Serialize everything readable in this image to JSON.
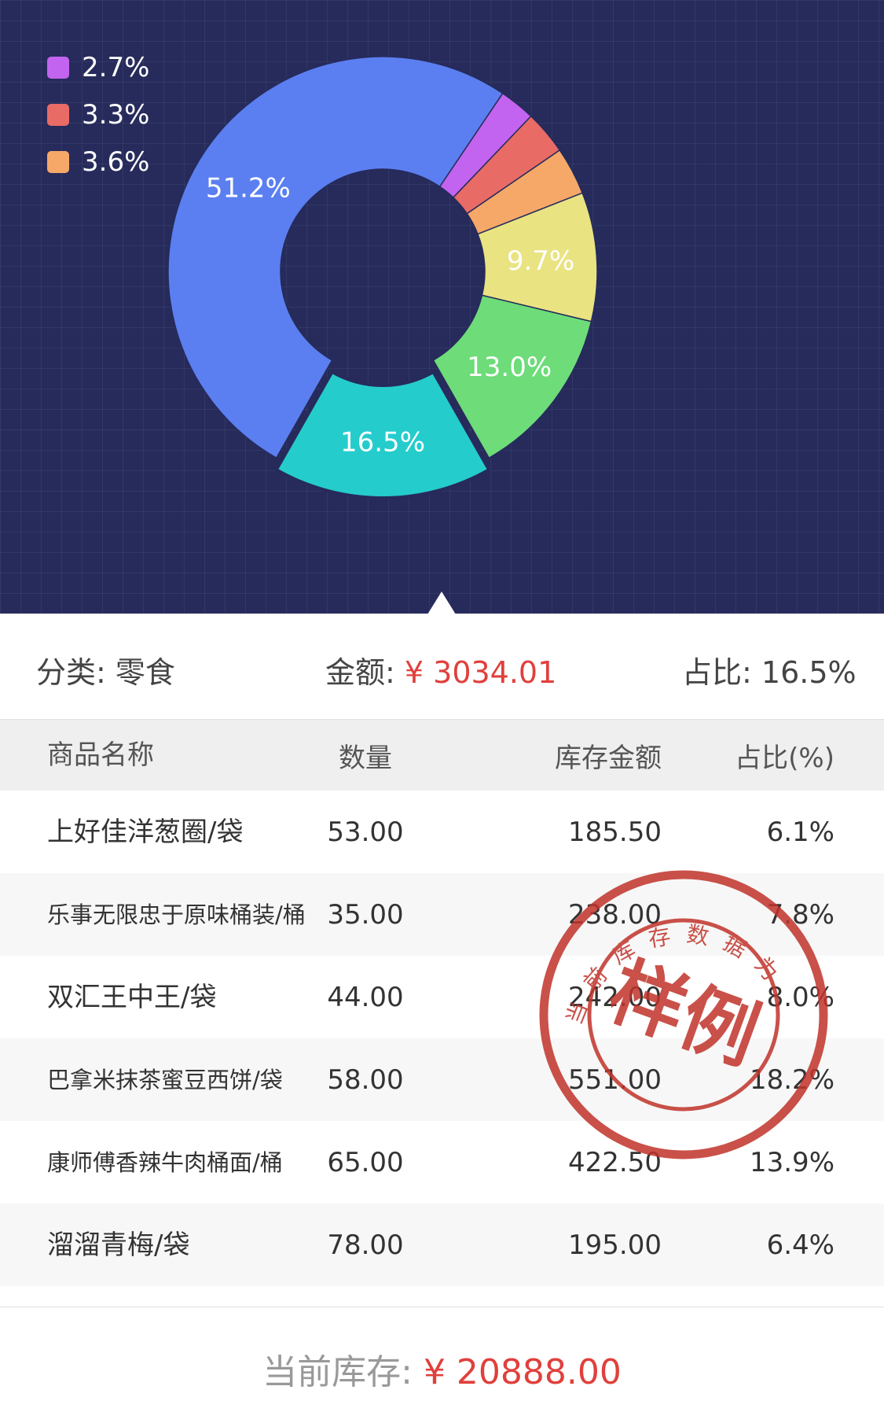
{
  "chart_data": {
    "type": "pie",
    "subtype": "donut",
    "slices": [
      {
        "label": "51.2%",
        "value": 51.2,
        "color": "#5b7ff0",
        "show_label": true
      },
      {
        "label": "2.7%",
        "value": 2.7,
        "color": "#c264ef",
        "show_label": false
      },
      {
        "label": "3.3%",
        "value": 3.3,
        "color": "#e86b66",
        "show_label": false
      },
      {
        "label": "3.6%",
        "value": 3.6,
        "color": "#f5a867",
        "show_label": false
      },
      {
        "label": "9.7%",
        "value": 9.7,
        "color": "#e9e382",
        "show_label": true
      },
      {
        "label": "13.0%",
        "value": 13.0,
        "color": "#6ddc79",
        "show_label": true
      },
      {
        "label": "16.5%",
        "value": 16.5,
        "color": "#25cccc",
        "show_label": true,
        "selected": true
      }
    ],
    "legend": [
      {
        "label": "2.7%",
        "color": "#c264ef"
      },
      {
        "label": "3.3%",
        "color": "#e86b66"
      },
      {
        "label": "3.6%",
        "color": "#f5a867"
      }
    ],
    "legend_position": "top-left",
    "background": "#262b5b"
  },
  "summary": {
    "category_label": "分类: ",
    "category_value": "零食",
    "amount_label": "金额: ",
    "amount_value": "¥ 3034.01",
    "ratio_label": "占比: ",
    "ratio_value": "16.5%"
  },
  "table": {
    "headers": [
      "商品名称",
      "数量",
      "库存金额",
      "占比(%)"
    ],
    "rows": [
      {
        "name": "上好佳洋葱圈/袋",
        "qty": "53.00",
        "amount": "185.50",
        "pct": "6.1%"
      },
      {
        "name": "乐事无限忠于原味桶装/桶",
        "qty": "35.00",
        "amount": "238.00",
        "pct": "7.8%"
      },
      {
        "name": "双汇王中王/袋",
        "qty": "44.00",
        "amount": "242.00",
        "pct": "8.0%"
      },
      {
        "name": "巴拿米抹茶蜜豆西饼/袋",
        "qty": "58.00",
        "amount": "551.00",
        "pct": "18.2%"
      },
      {
        "name": "康师傅香辣牛肉桶面/桶",
        "qty": "65.00",
        "amount": "422.50",
        "pct": "13.9%"
      },
      {
        "name": "溜溜青梅/袋",
        "qty": "78.00",
        "amount": "195.00",
        "pct": "6.4%"
      }
    ]
  },
  "footer": {
    "label": "当前库存: ",
    "value": "¥ 20888.00"
  },
  "stamp": {
    "main_text": "样例",
    "ring_text": "当前库存数据为"
  },
  "colors": {
    "accent_red": "#e0403c",
    "stamp_red": "#c0332a"
  }
}
